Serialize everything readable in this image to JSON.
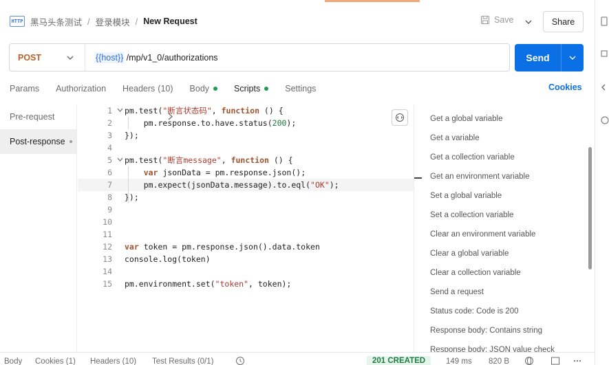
{
  "breadcrumb": {
    "items": [
      "黑马头条测试",
      "登录模块"
    ],
    "current": "New Request",
    "icon": "http-icon",
    "icon_text": "HTTP"
  },
  "toolbar": {
    "save_label": "Save",
    "share_label": "Share"
  },
  "request": {
    "method": "POST",
    "url_var": "{{host}}",
    "url_path": " /mp/v1_0/authorizations",
    "send_label": "Send"
  },
  "tabs": [
    {
      "label": "Params",
      "count": "",
      "dot": false,
      "active": false
    },
    {
      "label": "Authorization",
      "count": "",
      "dot": false,
      "active": false
    },
    {
      "label": "Headers",
      "count": "(10)",
      "dot": false,
      "active": false
    },
    {
      "label": "Body",
      "count": "",
      "dot": true,
      "active": false
    },
    {
      "label": "Scripts",
      "count": "",
      "dot": true,
      "active": true
    },
    {
      "label": "Settings",
      "count": "",
      "dot": false,
      "active": false
    }
  ],
  "cookies_label": "Cookies",
  "script_nav": [
    {
      "label": "Pre-request",
      "active": false
    },
    {
      "label": "Post-response",
      "active": true
    }
  ],
  "editor": {
    "lines": [
      {
        "n": "1",
        "fold": true,
        "code": "pm.test(\"断言状态码\", function () {"
      },
      {
        "n": "2",
        "fold": false,
        "code": "    pm.response.to.have.status(200);"
      },
      {
        "n": "3",
        "fold": false,
        "code": "});"
      },
      {
        "n": "4",
        "fold": false,
        "code": ""
      },
      {
        "n": "5",
        "fold": true,
        "code": "pm.test(\"断言message\", function () {"
      },
      {
        "n": "6",
        "fold": false,
        "code": "    var jsonData = pm.response.json();"
      },
      {
        "n": "7",
        "fold": false,
        "code": "    pm.expect(jsonData.message).to.eql(\"OK\");"
      },
      {
        "n": "8",
        "fold": false,
        "code": "});"
      },
      {
        "n": "9",
        "fold": false,
        "code": ""
      },
      {
        "n": "10",
        "fold": false,
        "code": ""
      },
      {
        "n": "11",
        "fold": false,
        "code": ""
      },
      {
        "n": "12",
        "fold": false,
        "code": "var token = pm.response.json().data.token"
      },
      {
        "n": "13",
        "fold": false,
        "code": "console.log(token)"
      },
      {
        "n": "14",
        "fold": false,
        "code": ""
      },
      {
        "n": "15",
        "fold": false,
        "code": "pm.environment.set(\"token\", token);"
      }
    ]
  },
  "snippets": [
    "Get a global variable",
    "Get a variable",
    "Get a collection variable",
    "Get an environment variable",
    "Set a global variable",
    "Set a collection variable",
    "Clear an environment variable",
    "Clear a global variable",
    "Clear a collection variable",
    "Send a request",
    "Status code: Code is 200",
    "Response body: Contains string",
    "Response body: JSON value check"
  ],
  "response_bar": {
    "tabs": [
      "Body",
      "Cookies (1)",
      "Headers (10)",
      "Test Results (0/1)"
    ],
    "status": "201 CREATED",
    "time": "149 ms",
    "size": "820 B"
  },
  "colors": {
    "accent": "#0b6fe6",
    "method": "#b8602a",
    "status_ok": "#1f7a43"
  }
}
